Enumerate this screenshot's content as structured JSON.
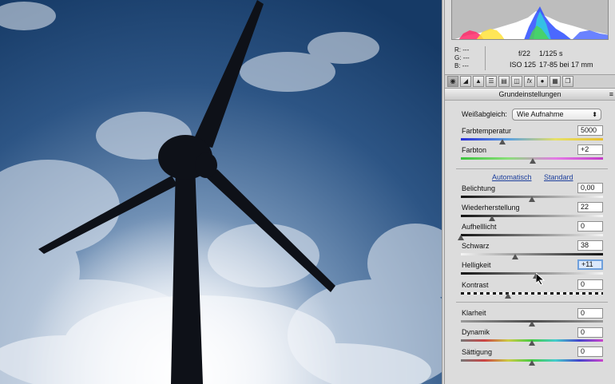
{
  "info": {
    "r_label": "R:",
    "r_value": "---",
    "g_label": "G:",
    "g_value": "---",
    "b_label": "B:",
    "b_value": "---",
    "aperture": "f/22",
    "shutter": "1/125 s",
    "iso": "ISO 125",
    "lens": "17-85 bei 17 mm"
  },
  "tabs": [
    "aperture-icon",
    "curve-icon",
    "detail-icon",
    "hsl-icon",
    "split-toning-icon",
    "lens-icon",
    "fx-icon",
    "camera-calibration-icon",
    "presets-icon",
    "snapshots-icon"
  ],
  "section": {
    "title": "Grundeinstellungen",
    "menu_icon": "≡"
  },
  "white_balance": {
    "label": "Weißabgleich:",
    "value": "Wie Aufnahme"
  },
  "links": {
    "auto": "Automatisch",
    "default": "Standard"
  },
  "controls": {
    "temperature": {
      "label": "Farbtemperatur",
      "value": "5000",
      "position": 0.29
    },
    "tint": {
      "label": "Farbton",
      "value": "+2",
      "position": 0.505
    },
    "exposure": {
      "label": "Belichtung",
      "value": "0,00",
      "position": 0.5
    },
    "recovery": {
      "label": "Wiederherstellung",
      "value": "22",
      "position": 0.22
    },
    "fill_light": {
      "label": "Aufhelllicht",
      "value": "0",
      "position": 0.0
    },
    "blacks": {
      "label": "Schwarz",
      "value": "38",
      "position": 0.38
    },
    "brightness": {
      "label": "Helligkeit",
      "value": "+11",
      "position": 0.53
    },
    "contrast": {
      "label": "Kontrast",
      "value": "0",
      "position": 0.33
    },
    "clarity": {
      "label": "Klarheit",
      "value": "0",
      "position": 0.5
    },
    "vibrance": {
      "label": "Dynamik",
      "value": "0",
      "position": 0.5
    },
    "saturation": {
      "label": "Sättigung",
      "value": "0",
      "position": 0.5
    }
  },
  "colors": {
    "link": "#1d3f9c",
    "focus": "#6fa0dc"
  }
}
